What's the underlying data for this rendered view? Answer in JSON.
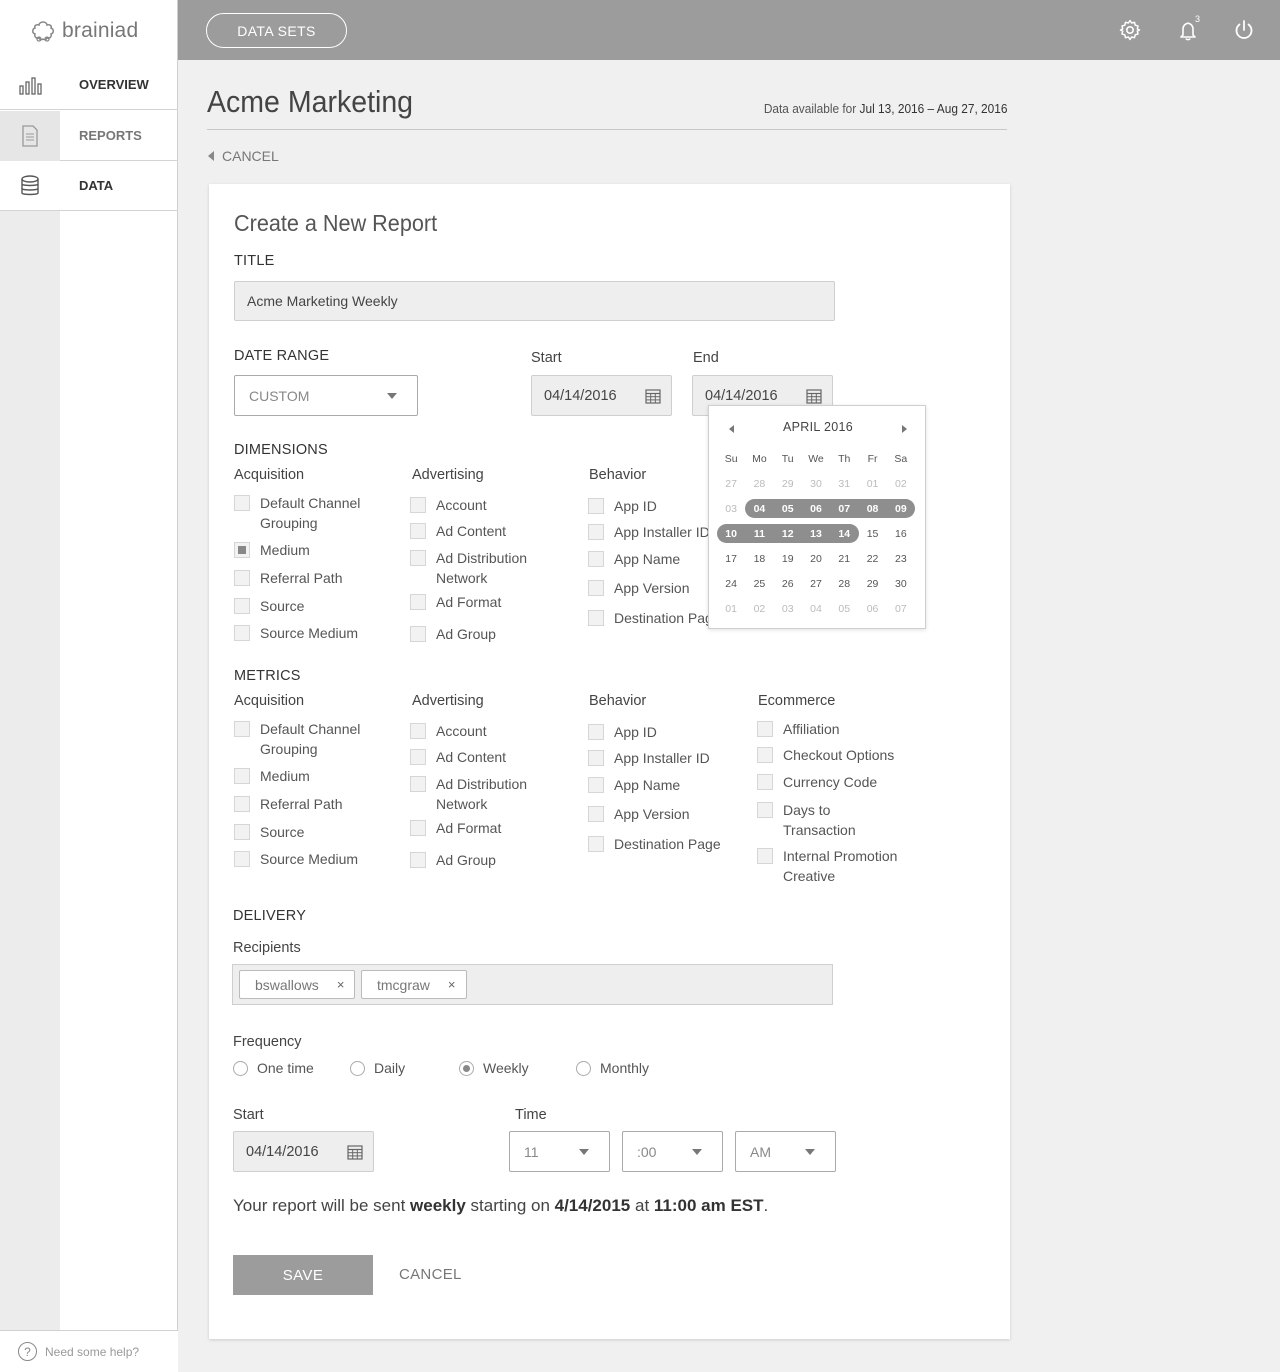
{
  "app": {
    "logo_text": "brainiad"
  },
  "sidebar": {
    "items": [
      {
        "label": "OVERVIEW",
        "icon": "bar-chart-icon"
      },
      {
        "label": "REPORTS",
        "icon": "document-icon"
      },
      {
        "label": "DATA",
        "icon": "database-icon"
      }
    ],
    "active": "REPORTS",
    "help_text": "Need some help?",
    "help_icon": "?"
  },
  "topbar": {
    "datasets_label": "DATA SETS",
    "notification_count": "3"
  },
  "header": {
    "title": "Acme Marketing",
    "availability_prefix": "Data available for",
    "availability_range": "Jul 13, 2016 – Aug 27, 2016",
    "back_cancel": "CANCEL"
  },
  "form": {
    "heading": "Create a New Report",
    "title_label": "TITLE",
    "title_value": "Acme Marketing Weekly",
    "date_range_label": "DATE RANGE",
    "date_range_value": "CUSTOM",
    "start_label": "Start",
    "start_value": "04/14/2016",
    "end_label": "End",
    "end_value": "04/14/2016",
    "dimensions_label": "DIMENSIONS",
    "metrics_label": "METRICS",
    "columns": {
      "acquisition": "Acquisition",
      "advertising": "Advertising",
      "behavior": "Behavior",
      "ecommerce": "Ecommerce"
    },
    "acquisition_items": [
      "Default Channel Grouping",
      "Medium",
      "Referral Path",
      "Source",
      "Source Medium"
    ],
    "advertising_items": [
      "Account",
      "Ad Content",
      "Ad Distribution Network",
      "Ad Format",
      "Ad Group"
    ],
    "behavior_items": [
      "App ID",
      "App Installer ID",
      "App Name",
      "App Version",
      "Destination Page"
    ],
    "ecommerce_items": [
      "Affiliation",
      "Checkout Options",
      "Currency Code",
      "Days to Transaction",
      "Internal Promotion Creative"
    ],
    "dimension_checked": [
      "Medium"
    ],
    "delivery_label": "DELIVERY",
    "recipients_label": "Recipients",
    "recipients": [
      "bswallows",
      "tmcgraw"
    ],
    "chip_remove_glyph": "×",
    "frequency_label": "Frequency",
    "frequency_options": [
      "One time",
      "Daily",
      "Weekly",
      "Monthly"
    ],
    "frequency_selected": "Weekly",
    "delivery_start_label": "Start",
    "delivery_start_value": "04/14/2016",
    "time_label": "Time",
    "time_hour": "11",
    "time_minute": ":00",
    "time_ampm": "AM",
    "summary": {
      "pre": "Your report will be sent ",
      "freq": "weekly",
      "mid": " starting on ",
      "date": "4/14/2015",
      "at": " at ",
      "time": "11:00 am EST",
      "end": "."
    },
    "save_label": "SAVE",
    "cancel_label": "CANCEL"
  },
  "calendar": {
    "month_label": "APRIL 2016",
    "weekdays": [
      "Su",
      "Mo",
      "Tu",
      "We",
      "Th",
      "Fr",
      "Sa"
    ],
    "weeks": [
      [
        "27",
        "28",
        "29",
        "30",
        "31",
        "01",
        "02"
      ],
      [
        "03",
        "04",
        "05",
        "06",
        "07",
        "08",
        "09"
      ],
      [
        "10",
        "11",
        "12",
        "13",
        "14",
        "15",
        "16"
      ],
      [
        "17",
        "18",
        "19",
        "20",
        "21",
        "22",
        "23"
      ],
      [
        "24",
        "25",
        "26",
        "27",
        "28",
        "29",
        "30"
      ],
      [
        "01",
        "02",
        "03",
        "04",
        "05",
        "06",
        "07"
      ]
    ],
    "muted_weeks": [
      0,
      5
    ],
    "muted_cells": [
      [
        1,
        0
      ]
    ],
    "selected_start": "04",
    "selected_end": "14"
  },
  "colors": {
    "topbar": "#9c9c9c",
    "accent": "#8e8e8e",
    "background": "#f0f0f0"
  }
}
